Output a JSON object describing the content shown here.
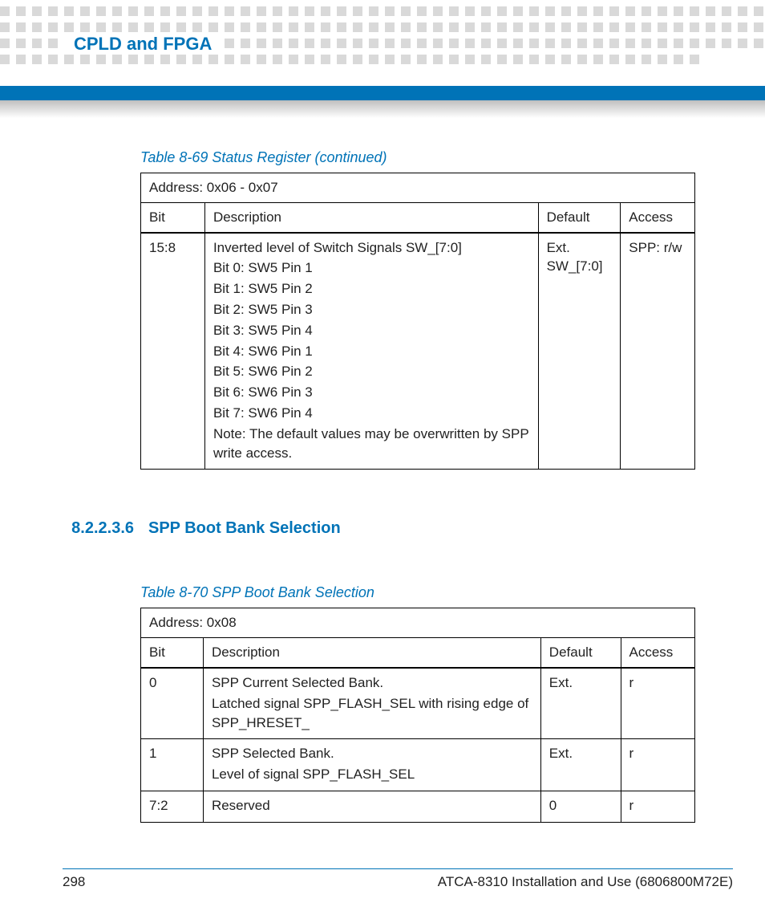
{
  "header": {
    "chapter_title": "CPLD and FPGA"
  },
  "table69": {
    "caption": "Table 8-69 Status Register (continued)",
    "address": "Address: 0x06 - 0x07",
    "columns": {
      "bit": "Bit",
      "desc": "Description",
      "def": "Default",
      "acc": "Access"
    },
    "row": {
      "bit": "15:8",
      "desc_lines": [
        "Inverted level of Switch Signals SW_[7:0]",
        "Bit 0: SW5 Pin 1",
        "Bit 1: SW5 Pin 2",
        "Bit 2: SW5 Pin 3",
        "Bit 3: SW5 Pin 4",
        "Bit 4: SW6 Pin 1",
        "Bit 5: SW6 Pin 2",
        "Bit 6: SW6 Pin 3",
        "Bit 7: SW6 Pin 4",
        "Note: The default values may be overwritten by SPP write access."
      ],
      "def": "Ext. SW_[7:0]",
      "acc": "SPP: r/w"
    }
  },
  "section": {
    "number": "8.2.2.3.6",
    "title": "SPP Boot Bank Selection"
  },
  "table70": {
    "caption": "Table 8-70 SPP Boot Bank Selection",
    "address": "Address: 0x08",
    "columns": {
      "bit": "Bit",
      "desc": "Description",
      "def": "Default",
      "acc": "Access"
    },
    "rows": [
      {
        "bit": "0",
        "desc_lines": [
          "SPP Current Selected Bank.",
          "Latched signal SPP_FLASH_SEL with rising edge of SPP_HRESET_"
        ],
        "def": "Ext.",
        "acc": "r"
      },
      {
        "bit": "1",
        "desc_lines": [
          "SPP Selected Bank.",
          "Level of signal SPP_FLASH_SEL"
        ],
        "def": "Ext.",
        "acc": "r"
      },
      {
        "bit": "7:2",
        "desc_lines": [
          "Reserved"
        ],
        "def": "0",
        "acc": "r"
      }
    ]
  },
  "footer": {
    "page_number": "298",
    "doc_title": "ATCA-8310 Installation and Use (6806800M72E)"
  }
}
